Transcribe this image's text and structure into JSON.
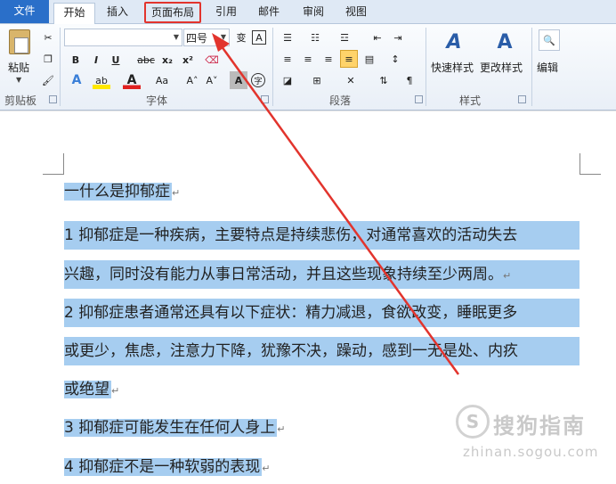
{
  "tabs": {
    "file": "文件",
    "home": "开始",
    "insert": "插入",
    "layout": "页面布局",
    "references": "引用",
    "mailings": "邮件",
    "review": "审阅",
    "view": "视图"
  },
  "clipboard": {
    "paste": "粘贴",
    "group": "剪贴板"
  },
  "font": {
    "size": "四号",
    "group": "字体",
    "bold": "B",
    "italic": "I",
    "underline": "U",
    "strike": "abc",
    "subscript": "x₂",
    "superscript": "x²",
    "change_case": "Aa",
    "grow": "A˄",
    "shrink": "A˅",
    "phonetic": "变",
    "border_char": "A"
  },
  "paragraph": {
    "group": "段落"
  },
  "styles": {
    "quick": "快速样式",
    "change": "更改样式",
    "group": "样式"
  },
  "editing": {
    "label": "编辑"
  },
  "document": {
    "lines": [
      "一什么是抑郁症",
      "1 抑郁症是一种疾病，主要特点是持续悲伤，对通常喜欢的活动失去",
      "兴趣，同时没有能力从事日常活动，并且这些现象持续至少两周。",
      "2 抑郁症患者通常还具有以下症状：精力减退，食欲改变，睡眠更多",
      "或更少，焦虑，注意力下降，犹豫不决，躁动，感到一无是处、内疚",
      "或绝望",
      "3 抑郁症可能发生在任何人身上",
      "4 抑郁症不是一种软弱的表现"
    ],
    "para_mark": "↵"
  },
  "watermark": {
    "logo": "S",
    "text": "搜狗指南",
    "url": "zhinan.sogou.com"
  },
  "colors": {
    "file_tab": "#2a6fc9",
    "highlight": "#a6cdf0",
    "annotation": "#e2342d"
  }
}
